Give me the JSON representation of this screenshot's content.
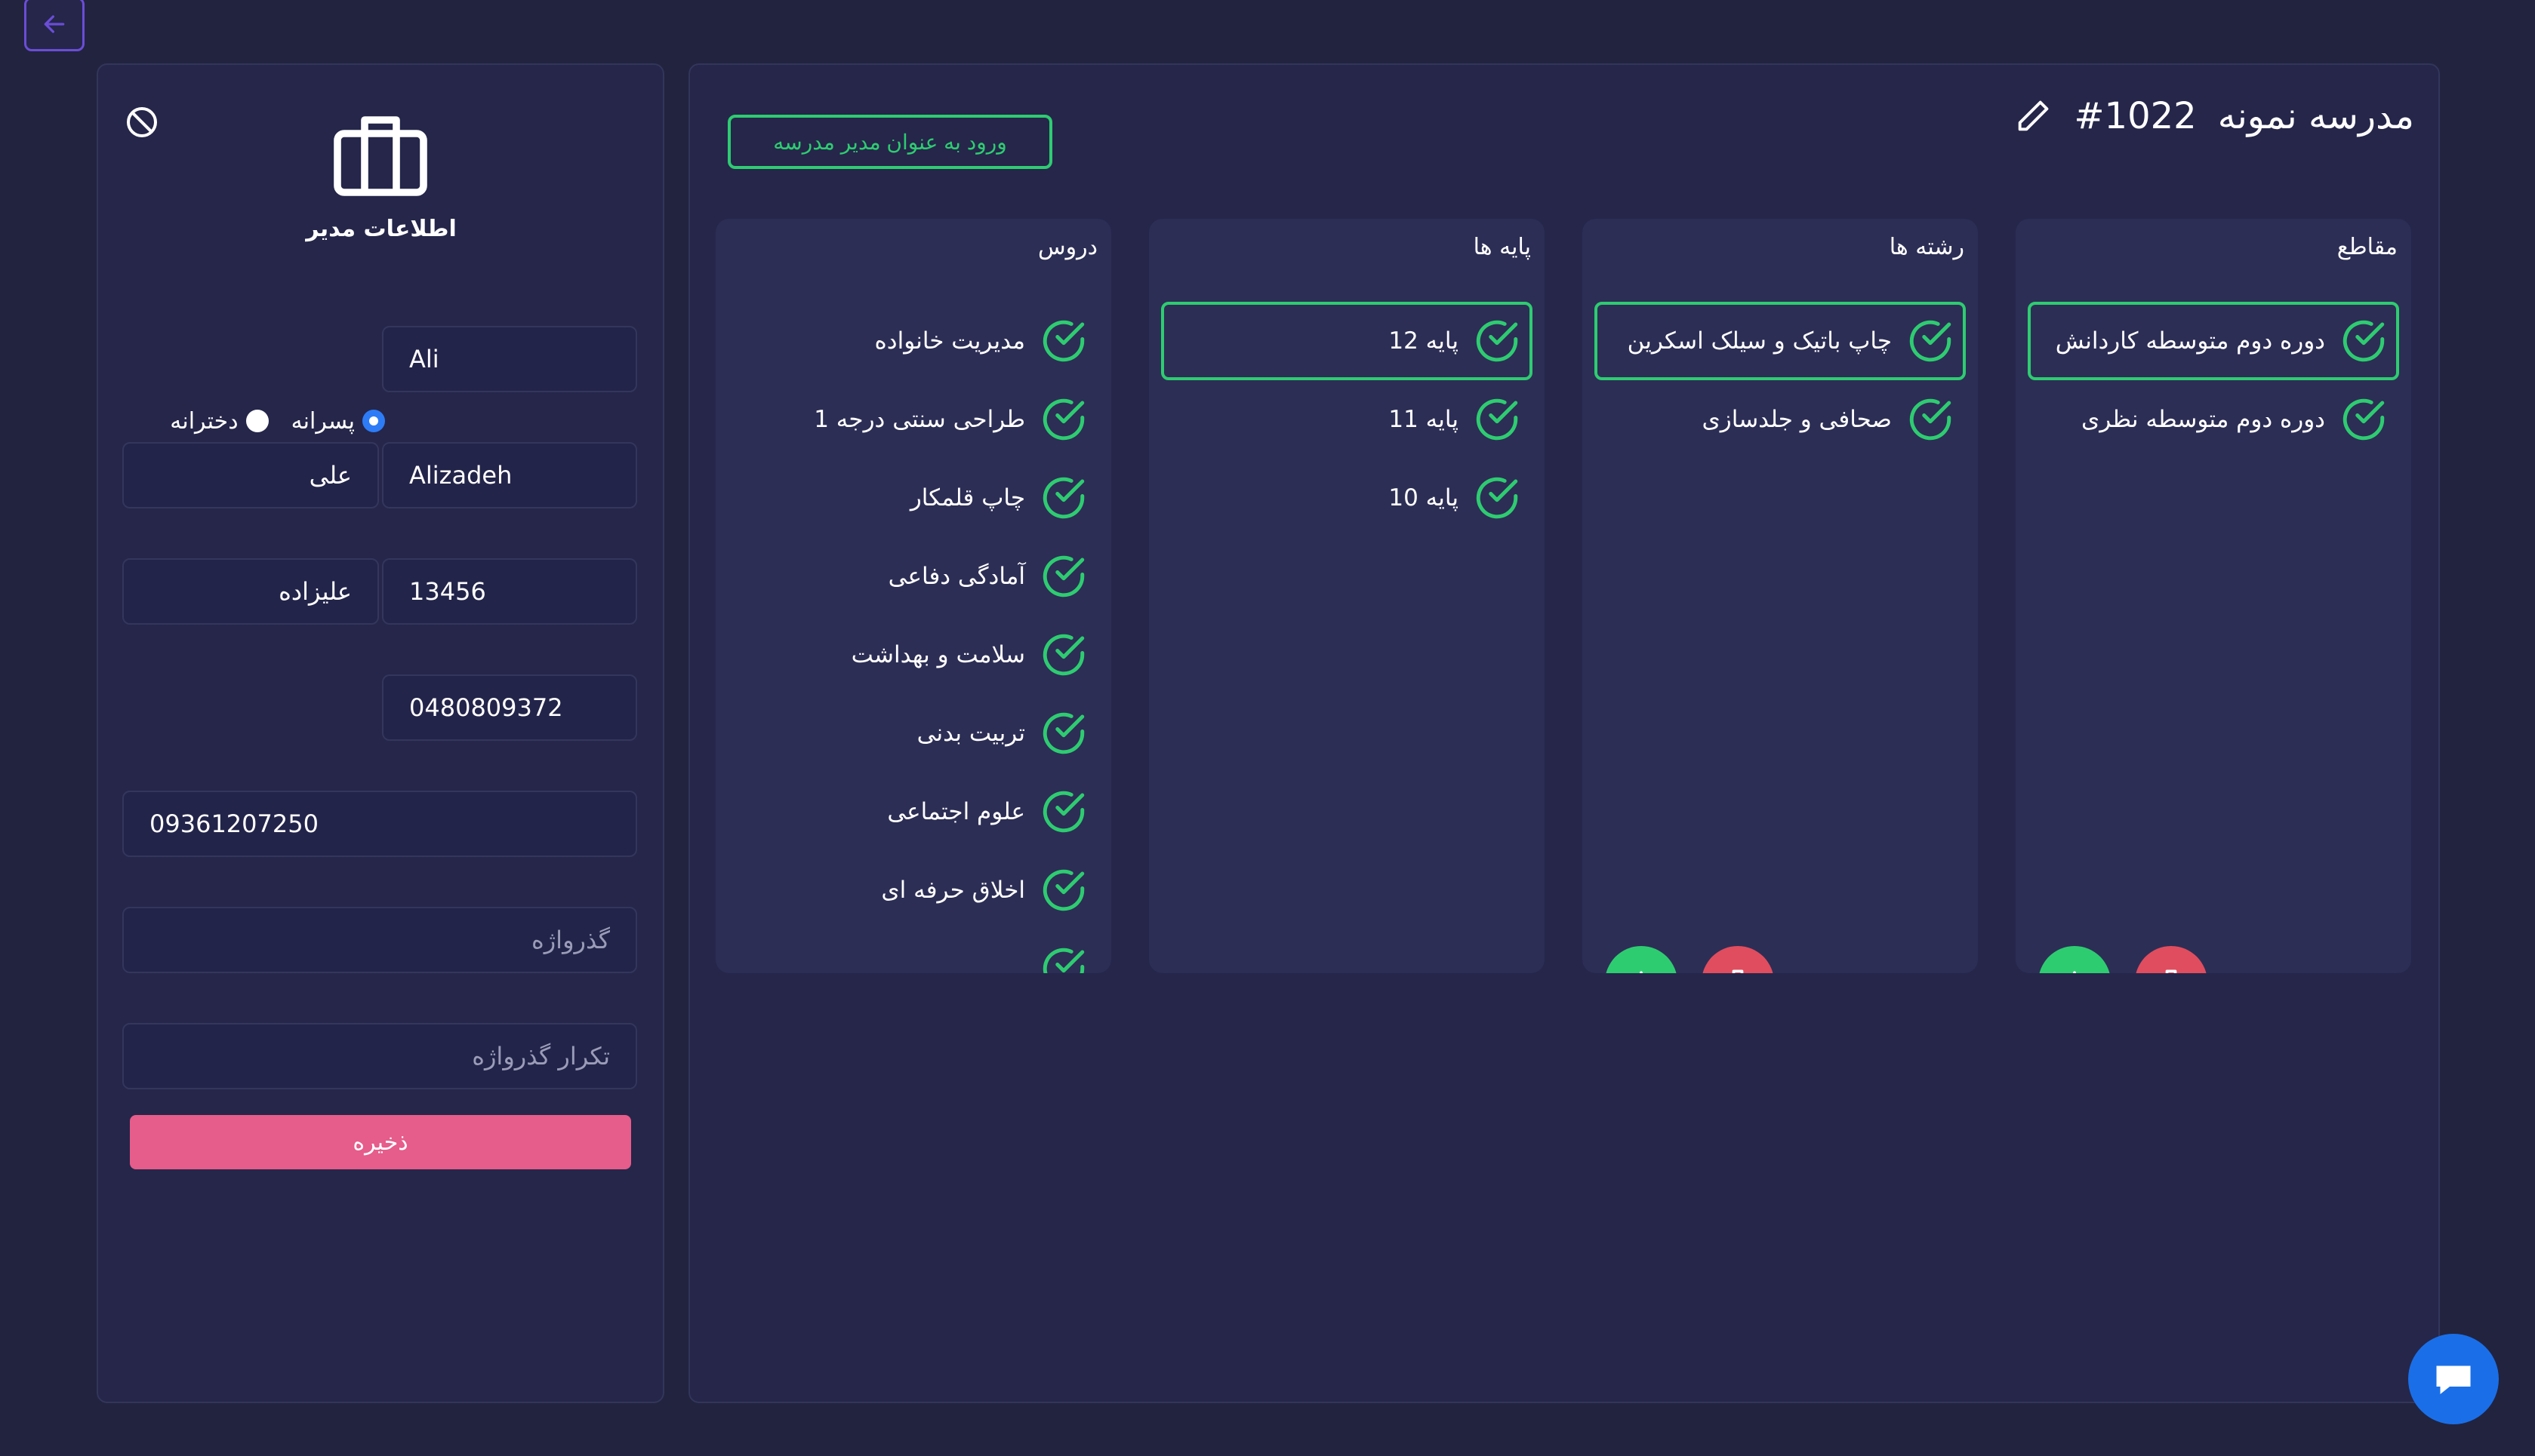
{
  "admin": {
    "title": "اطلاعات مدیر",
    "gender_options": [
      {
        "label": "پسرانه",
        "selected": true
      },
      {
        "label": "دخترانه",
        "selected": false
      }
    ],
    "first_name_en": "Ali",
    "first_name_fa": "علی",
    "last_name_en": "Alizadeh",
    "last_name_fa": "علیزاده",
    "code": "13456",
    "national_id": "0480809372",
    "phone": "09361207250",
    "password_placeholder": "گذرواژه",
    "password_repeat_placeholder": "تکرار گذرواژه",
    "save_label": "ذخیره"
  },
  "school": {
    "title": "مدرسه نمونه",
    "id": "#1022",
    "login_label": "ورود به عنوان مدیر مدرسه"
  },
  "columns": {
    "sections": {
      "title": "مقاطع",
      "items": [
        "دوره دوم متوسطه کاردانش",
        "دوره دوم متوسطه نظری"
      ]
    },
    "fields": {
      "title": "رشته ها",
      "items": [
        "چاپ باتیک و سیلک اسکرین",
        "صحافی و جلدسازی"
      ]
    },
    "grades": {
      "title": "پایه ها",
      "items": [
        "پایه 12",
        "پایه 11",
        "پایه 10"
      ]
    },
    "courses": {
      "title": "دروس",
      "items": [
        "مدیریت خانواده",
        "طراحی سنتی درجه 1",
        "چاپ قلمکار",
        "آمادگی دفاعی",
        "سلامت و بهداشت",
        "تربیت بدنی",
        "علوم اجتماعی",
        "اخلاق حرفه ای"
      ]
    }
  },
  "colors": {
    "background": "#22233f",
    "panel": "#25264a",
    "column": "#2c2e55",
    "accent_green": "#2ecc71",
    "accent_red": "#e04d5e",
    "save_pink": "#e65c8a",
    "chat_blue": "#1a6fe8"
  },
  "icons": [
    "back-arrow-icon",
    "ban-icon",
    "briefcase-icon",
    "pencil-icon",
    "check-circle-icon",
    "plus-icon",
    "trash-icon",
    "chat-icon"
  ]
}
